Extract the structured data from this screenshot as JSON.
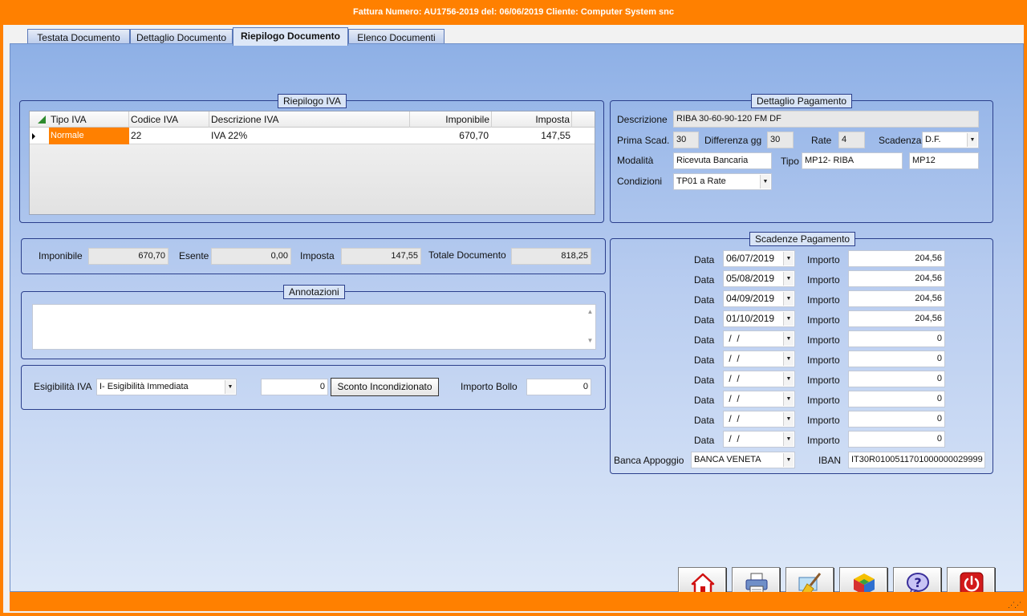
{
  "window": {
    "title": "Fattura  Numero: AU1756-2019 del: 06/06/2019 Cliente: Computer System snc"
  },
  "tabs": [
    {
      "label": "Testata Documento",
      "active": false
    },
    {
      "label": "Dettaglio Documento",
      "active": false
    },
    {
      "label": "Riepilogo Documento",
      "active": true
    },
    {
      "label": "Elenco Documenti",
      "active": false
    }
  ],
  "riepilogo_iva": {
    "title": "Riepilogo IVA",
    "columns": [
      "Tipo IVA",
      "Codice IVA",
      "Descrizione IVA",
      "Imponibile",
      "Imposta"
    ],
    "rows": [
      {
        "tipo": "Normale",
        "codice": "22",
        "descrizione": "IVA 22%",
        "imponibile": "670,70",
        "imposta": "147,55"
      }
    ]
  },
  "totali": {
    "imponibile_label": "Imponibile",
    "imponibile": "670,70",
    "esente_label": "Esente",
    "esente": "0,00",
    "imposta_label": "Imposta",
    "imposta": "147,55",
    "totale_label": "Totale Documento",
    "totale": "818,25"
  },
  "annotazioni": {
    "title": "Annotazioni",
    "value": ""
  },
  "esigibilita": {
    "label": "Esigibilità IVA",
    "value": "I- Esigibilità Immediata",
    "sconto_value": "0",
    "sconto_button": "Sconto Incondizionato",
    "bollo_label": "Importo Bollo",
    "bollo_value": "0"
  },
  "pagamento": {
    "title": "Dettaglio Pagamento",
    "descrizione_label": "Descrizione",
    "descrizione": "RIBA 30-60-90-120 FM DF",
    "prima_scad_label": "Prima Scad.",
    "prima_scad": "30",
    "differenza_label": "Differenza gg",
    "differenza": "30",
    "rate_label": "Rate",
    "rate": "4",
    "scadenza_label": "Scadenza",
    "scadenza": "D.F.",
    "modalita_label": "Modalità",
    "modalita": "Ricevuta Bancaria",
    "tipo_label": "Tipo",
    "tipo": "MP12- RIBA",
    "tipo_code": "MP12",
    "condizioni_label": "Condizioni",
    "condizioni": "TP01 a Rate"
  },
  "scadenze": {
    "title": "Scadenze Pagamento",
    "data_label": "Data",
    "importo_label": "Importo",
    "rows": [
      {
        "data": "06/07/2019",
        "importo": "204,56"
      },
      {
        "data": "05/08/2019",
        "importo": "204,56"
      },
      {
        "data": "04/09/2019",
        "importo": "204,56"
      },
      {
        "data": "01/10/2019",
        "importo": "204,56"
      },
      {
        "data": " /  /",
        "importo": "0"
      },
      {
        "data": " /  /",
        "importo": "0"
      },
      {
        "data": " /  /",
        "importo": "0"
      },
      {
        "data": " /  /",
        "importo": "0"
      },
      {
        "data": " /  /",
        "importo": "0"
      },
      {
        "data": " /  /",
        "importo": "0"
      }
    ],
    "banca_label": "Banca Appoggio",
    "banca": "BANCA VENETA",
    "iban_label": "IBAN",
    "iban": "IT30R0100511701000000029999"
  },
  "toolbar": {
    "buttons": [
      {
        "icon": "home-icon"
      },
      {
        "icon": "printer-icon"
      },
      {
        "icon": "broom-clean-icon"
      },
      {
        "icon": "cube-icon"
      },
      {
        "icon": "help-icon"
      },
      {
        "icon": "power-icon"
      }
    ]
  },
  "colors": {
    "accent": "#ff8000",
    "border": "#2b3f8c",
    "selected_row": "#ff8000"
  }
}
